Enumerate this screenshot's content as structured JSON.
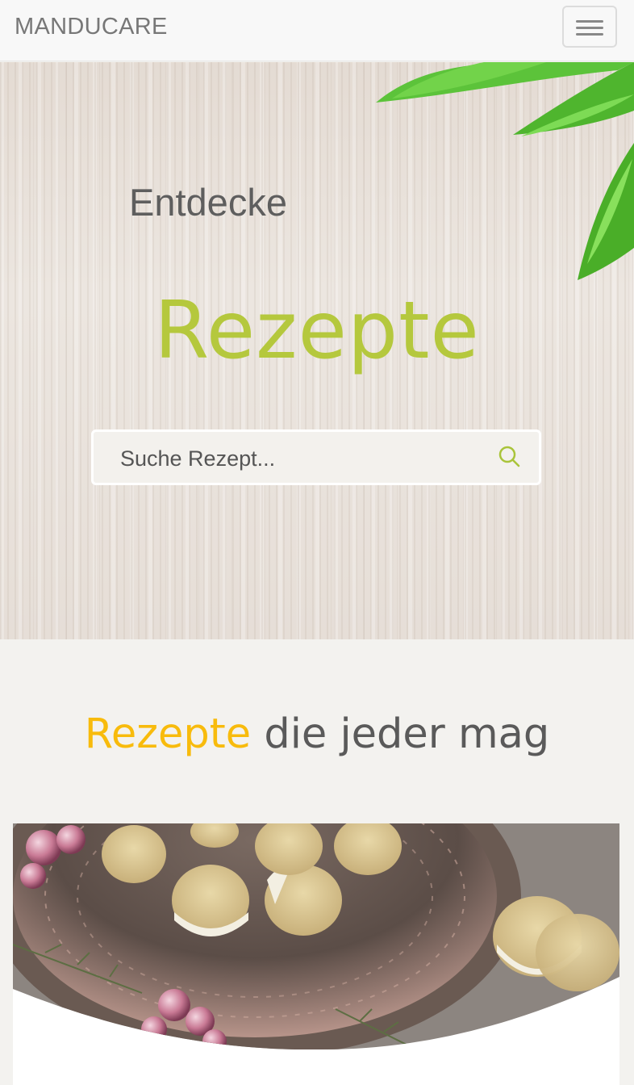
{
  "navbar": {
    "brand": "MANDUCARE",
    "menu_icon": "hamburger-menu-icon"
  },
  "hero": {
    "small_title": "Entdecke",
    "big_title": "Rezepte",
    "search": {
      "placeholder": "Suche Rezept...",
      "icon": "search-icon"
    }
  },
  "section": {
    "title_accent": "Rezepte",
    "title_rest": "die jeder mag"
  },
  "colors": {
    "accent_green": "#b5c83d",
    "accent_yellow": "#f8bb0c",
    "text_gray": "#5a5a5a"
  }
}
